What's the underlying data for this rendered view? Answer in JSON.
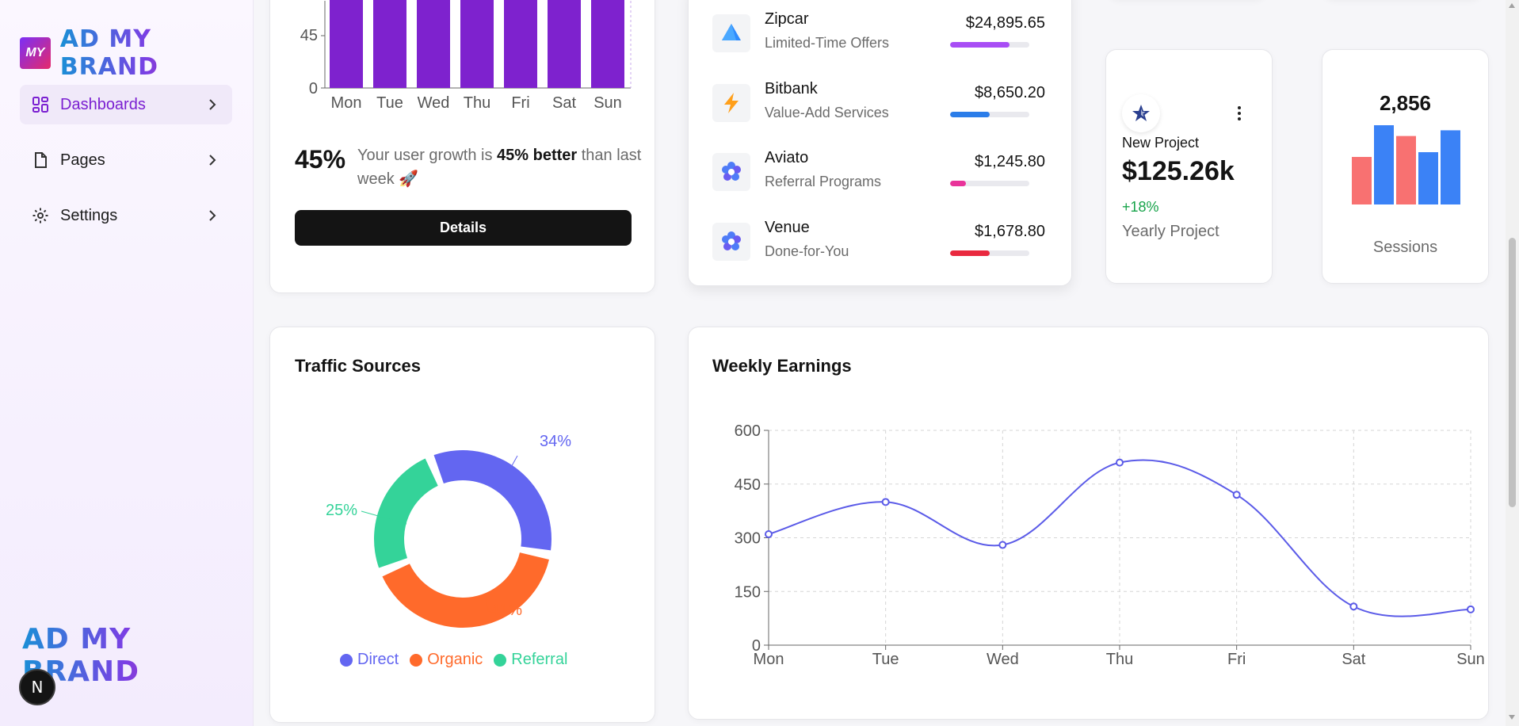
{
  "sidebar": {
    "logo_mark": "MY",
    "logo_text": "AD MY BRAND",
    "items": [
      {
        "label": "Dashboards",
        "icon": "dashboard-icon",
        "active": true
      },
      {
        "label": "Pages",
        "icon": "file-icon",
        "active": false
      },
      {
        "label": "Settings",
        "icon": "gear-icon",
        "active": false
      }
    ],
    "bottom_logo_text": "AD MY BRAND",
    "badge": "N"
  },
  "growth": {
    "chart_data": {
      "type": "bar",
      "categories": [
        "Mon",
        "Tue",
        "Wed",
        "Thu",
        "Fri",
        "Sat",
        "Sun"
      ],
      "y_ticks": [
        "0",
        "45"
      ],
      "color": "#7e22ce"
    },
    "percent": "45%",
    "text_before": "Your user growth is ",
    "text_bold": "45% better",
    "text_after": " than last week 🚀",
    "button_label": "Details"
  },
  "brands": [
    {
      "name": "Zipcar",
      "sub": "Limited-Time Offers",
      "amount": "$24,895.65",
      "progress": 0.75,
      "color": "#a84df5",
      "icon": "zipcar-icon"
    },
    {
      "name": "Bitbank",
      "sub": "Value-Add Services",
      "amount": "$8,650.20",
      "progress": 0.5,
      "color": "#2b7de9",
      "icon": "lightning-icon"
    },
    {
      "name": "Aviato",
      "sub": "Referral Programs",
      "amount": "$1,245.80",
      "progress": 0.2,
      "color": "#e9339a",
      "icon": "aviato-icon"
    },
    {
      "name": "Venue",
      "sub": "Done-for-You",
      "amount": "$1,678.80",
      "progress": 0.5,
      "color": "#e9293f",
      "icon": "venue-icon"
    }
  ],
  "project": {
    "icon": "star-icon",
    "label": "New Project",
    "value": "$125.26k",
    "change": "+18%",
    "sub": "Yearly Project"
  },
  "sessions": {
    "value": "2,856",
    "label": "Sessions",
    "bars": [
      {
        "value": 0.5,
        "color": "#f87171"
      },
      {
        "value": 0.95,
        "color": "#3b82f6"
      },
      {
        "value": 0.72,
        "color": "#f87171"
      },
      {
        "value": 0.55,
        "color": "#3b82f6"
      },
      {
        "value": 0.78,
        "color": "#3b82f6"
      }
    ]
  },
  "traffic": {
    "title": "Traffic Sources",
    "chart_data": {
      "type": "pie",
      "series": [
        {
          "name": "Direct",
          "value": 34,
          "label": "34%",
          "color": "#6366f1"
        },
        {
          "name": "Organic",
          "value": 41,
          "label": "41%",
          "color": "#ff6a2b"
        },
        {
          "name": "Referral",
          "value": 25,
          "label": "25%",
          "color": "#34d399"
        }
      ]
    }
  },
  "weekly": {
    "title": "Weekly Earnings",
    "chart_data": {
      "type": "line",
      "categories": [
        "Mon",
        "Tue",
        "Wed",
        "Thu",
        "Fri",
        "Sat",
        "Sun"
      ],
      "values": [
        310,
        400,
        280,
        510,
        420,
        108,
        100
      ],
      "ylim": [
        0,
        600
      ],
      "y_ticks": [
        0,
        150,
        300,
        450,
        600
      ],
      "grid": true,
      "color": "#5b5be8"
    }
  }
}
